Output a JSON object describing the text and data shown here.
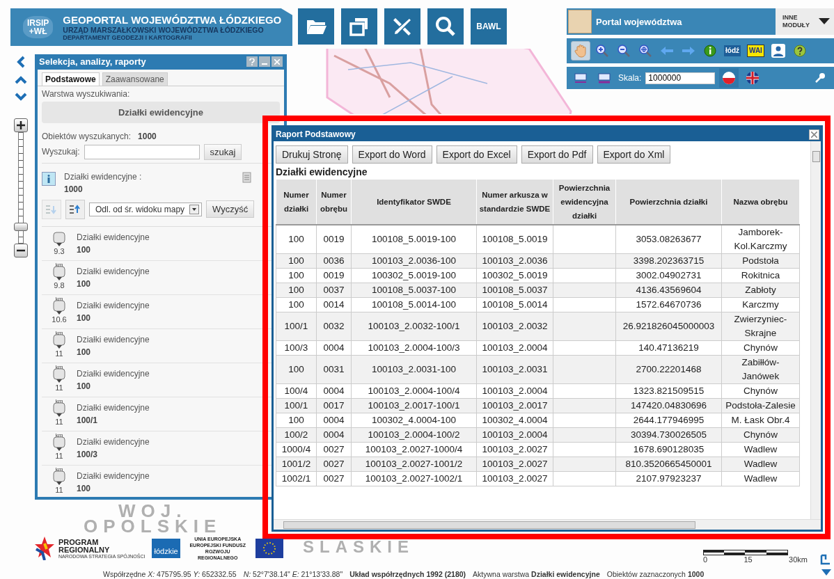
{
  "header": {
    "logo_lines": [
      "IRSIP",
      "+WŁ"
    ],
    "title": "GEOPORTAL WOJEWÓDZTWA ŁÓDZKIEGO",
    "subtitle": "URZĄD MARSZAŁKOWSKI WOJEWÓDZTWA ŁÓDZKIEGO",
    "department": "DEPARTAMENT GEODEZJI I KARTOGRAFII"
  },
  "main_tools": [
    {
      "kind": "folder"
    },
    {
      "kind": "windows"
    },
    {
      "kind": "tools"
    },
    {
      "kind": "search"
    },
    {
      "kind": "text",
      "label": "BAWL"
    }
  ],
  "portal": {
    "title": "Portal województwa",
    "modules_button": "INNE MODUŁY"
  },
  "map_tools": [
    {
      "kind": "pan",
      "selected": true
    },
    {
      "kind": "zoom-in",
      "selected": false
    },
    {
      "kind": "zoom-out",
      "selected": false
    },
    {
      "kind": "zoom-extent",
      "selected": false
    },
    {
      "kind": "back",
      "selected": false
    },
    {
      "kind": "forward",
      "selected": false
    },
    {
      "kind": "info",
      "selected": false
    },
    {
      "kind": "badge-blue",
      "label": "łódź",
      "selected": false
    },
    {
      "kind": "badge-yellow",
      "label": "WAI",
      "selected": false
    },
    {
      "kind": "user",
      "selected": false
    },
    {
      "kind": "help",
      "selected": false
    }
  ],
  "scale_row": {
    "label": "Skala:",
    "value": "1000000",
    "languages": [
      {
        "kind": "pl",
        "selected": true
      },
      {
        "kind": "en",
        "selected": false
      }
    ]
  },
  "zoom_slider": {
    "level": 0.15
  },
  "panel": {
    "title": "Selekcja, analizy, raporty",
    "tabs": [
      {
        "label": "Podstawowe",
        "selected": true
      },
      {
        "label": "Zaawansowane",
        "selected": false
      }
    ],
    "layer_label": "Warstwa wyszukiwania:",
    "layer": "Działki ewidencyjne",
    "found_label": "Obiektów wyszukanych:",
    "found": "1000",
    "search_label": "Wyszukaj:",
    "search_button": "szukaj",
    "summary_layer": "Działki ewidencyjne :",
    "summary_count": "1000",
    "sort_select": "Odl. od śr. widoku mapy",
    "clear_button": "Wyczyść",
    "results": [
      {
        "distance": "9.3",
        "layer": "Działki ewidencyjne",
        "number": "100"
      },
      {
        "unit": "km",
        "distance": "9.8",
        "layer": "Działki ewidencyjne",
        "number": "100"
      },
      {
        "unit": "km",
        "distance": "10.6",
        "layer": "Działki ewidencyjne",
        "number": "100"
      },
      {
        "unit": "km",
        "distance": "11",
        "layer": "Działki ewidencyjne",
        "number": "100"
      },
      {
        "unit": "km",
        "distance": "11",
        "layer": "Działki ewidencyjne",
        "number": "100"
      },
      {
        "unit": "km",
        "distance": "11",
        "layer": "Działki ewidencyjne",
        "number": "100/1"
      },
      {
        "unit": "km",
        "distance": "11",
        "layer": "Działki ewidencyjne",
        "number": "100/3"
      },
      {
        "unit": "km",
        "distance": "11",
        "layer": "Działki ewidencyjne",
        "number": "100"
      }
    ]
  },
  "report": {
    "title": "Raport Podstawowy",
    "buttons": [
      "Drukuj Stronę",
      "Export do Word",
      "Export do Excel",
      "Export do Pdf",
      "Export do Xml"
    ],
    "heading": "Działki ewidencyjne",
    "columns": [
      "Numer działki",
      "Numer obrębu",
      "Identyfikator SWDE",
      "Numer arkusza w standardzie SWDE",
      "Powierzchnia ewidencyjna działki",
      "Powierzchnia działki",
      "Nazwa obrębu"
    ],
    "rows": [
      [
        "100",
        "0019",
        "100108_5.0019-100",
        "100108_5.0019",
        "",
        "3053.08263677",
        "Jamborek-Kol.Karczmy"
      ],
      [
        "100",
        "0036",
        "100103_2.0036-100",
        "100103_2.0036",
        "",
        "3398.202363715",
        "Podstoła"
      ],
      [
        "100",
        "0019",
        "100302_5.0019-100",
        "100302_5.0019",
        "",
        "3002.04902731",
        "Rokitnica"
      ],
      [
        "100",
        "0037",
        "100108_5.0037-100",
        "100108_5.0037",
        "",
        "4136.43569604",
        "Zabłoty"
      ],
      [
        "100",
        "0014",
        "100108_5.0014-100",
        "100108_5.0014",
        "",
        "1572.64670736",
        "Karczmy"
      ],
      [
        "100/1",
        "0032",
        "100103_2.0032-100/1",
        "100103_2.0032",
        "",
        "26.921826045000003",
        "Zwierzyniec-Skrajne"
      ],
      [
        "100/3",
        "0004",
        "100103_2.0004-100/3",
        "100103_2.0004",
        "",
        "140.47136219",
        "Chynów"
      ],
      [
        "100",
        "0031",
        "100103_2.0031-100",
        "100103_2.0031",
        "",
        "2700.22201468",
        "Zabiłłów-Janówek"
      ],
      [
        "100/4",
        "0004",
        "100103_2.0004-100/4",
        "100103_2.0004",
        "",
        "1323.821509515",
        "Chynów"
      ],
      [
        "100/1",
        "0017",
        "100103_2.0017-100/1",
        "100103_2.0017",
        "",
        "147420.04830696",
        "Podstoła-Zalesie"
      ],
      [
        "100",
        "0004",
        "100302_4.0004-100",
        "100302_4.0004",
        "",
        "2644.177946995",
        "M. Łask Obr.4"
      ],
      [
        "100/2",
        "0004",
        "100103_2.0004-100/2",
        "100103_2.0004",
        "",
        "30394.730026505",
        "Chynów"
      ],
      [
        "1000/4",
        "0027",
        "100103_2.0027-1000/4",
        "100103_2.0027",
        "",
        "1678.690128035",
        "Wadlew"
      ],
      [
        "1001/2",
        "0027",
        "100103_2.0027-1001/2",
        "100103_2.0027",
        "",
        "810.3520665450001",
        "Wadlew"
      ],
      [
        "1002/1",
        "0027",
        "100103_2.0027-1002/1",
        "100103_2.0027",
        "",
        "2107.97923237",
        "Wadlew"
      ]
    ]
  },
  "map_labels": [
    "WOJ.",
    "OPOLSKIE",
    "SLASKIE"
  ],
  "sponsors": {
    "program": "PROGRAM REGIONALNY",
    "program_sub": "NARODOWA STRATEGIA SPÓJNOŚCI",
    "region": "łódzkie",
    "eu": "UNIA EUROPEJSKA EUROPEJSKI FUNDUSZ ROZWOJU REGIONALNEGO"
  },
  "scale_bar": [
    "0",
    "15",
    "30km"
  ],
  "status_bar": [
    "Współrzędne *X:* 475795.95 *Y:* 652332.55",
    "*N:* 52°7'38.14\" *E:* 21°13'33.88\"",
    "**Układ współrzędnych 1992 (2180)**",
    "Aktywna warstwa **Działki ewidencyjne**",
    "Obiektów zaznaczonych **1000**"
  ]
}
